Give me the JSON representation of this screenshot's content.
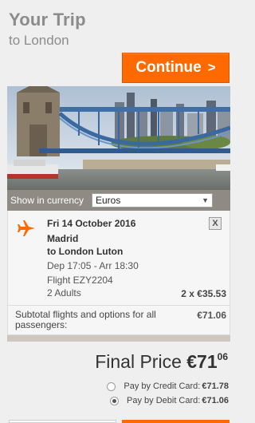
{
  "header": {
    "title": "Your Trip",
    "subtitle": "to London",
    "continue_label": "Continue",
    "continue_chevron": ">"
  },
  "photo": {
    "icon": "tower-bridge-photo"
  },
  "currency": {
    "label": "Show in currency",
    "selected": "Euros"
  },
  "flight": {
    "date": "Fri 14 October 2016",
    "from": "Madrid",
    "to": "to London Luton",
    "times": "Dep 17:05 - Arr 18:30",
    "flight_number": "Flight EZY2204",
    "passengers": "2 Adults",
    "price": "2 x €35.53",
    "remove_label": "X"
  },
  "subtotal": {
    "label": "Subtotal flights and options for all passengers:",
    "value": "€71.06"
  },
  "final": {
    "label": "Final Price",
    "amount": "€71",
    "cents": "06"
  },
  "payment": {
    "options": [
      {
        "label": "Pay by Credit Card:",
        "amount": "€71.78",
        "selected": false
      },
      {
        "label": "Pay by Debit Card:",
        "amount": "€71.06",
        "selected": true
      }
    ]
  },
  "colors": {
    "accent": "#ff6a00",
    "currency_bar": "#8f8a84",
    "card_bg": "#f6f6f6"
  }
}
